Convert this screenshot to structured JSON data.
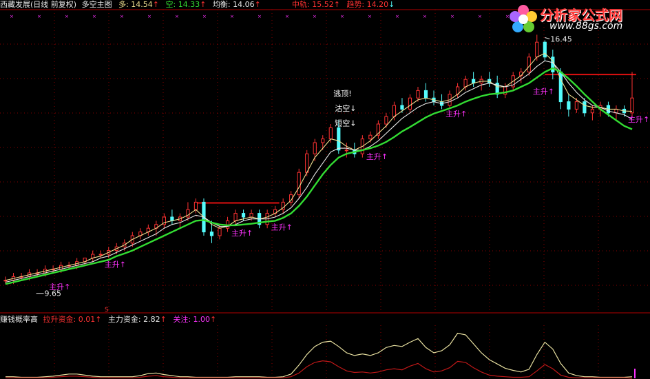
{
  "header": {
    "name": "西藏发展(日线 前复权)",
    "indicator": "多空主图",
    "long_label": "多: 14.54",
    "short_label": "空: 14.33",
    "balance_label": "均衡: 14.06",
    "mid_label": "中轨: 15.52",
    "trend_label": "趋势: 14.20",
    "arrow_up": "↑",
    "arrow_down": "↓"
  },
  "sub_header": {
    "name": "赚钱概率高",
    "pull_label": "拉升资金: 0.01",
    "main_label": "主力资金: 2.82",
    "focus_label": "关注: 1.00",
    "arrow_up": "↑"
  },
  "logo": {
    "title": "分析家公式网",
    "url": "www.88gs.com"
  },
  "annotations": {
    "escape_top": "逃顶!",
    "clear_short": "沽空↓",
    "short_short": "短空↓",
    "high_price": "16.45",
    "low_price": "9.65",
    "signal": "主升↑",
    "marker_s": "S"
  },
  "colors": {
    "background": "#000000",
    "up": "#ff3232",
    "down": "#54fcfc",
    "ma_green": "#33dd33",
    "ma_white": "#e8e8e8",
    "ma_yellow": "#f0e090",
    "resistance": "#e01010",
    "pull_line": "#c01818",
    "main_line": "#e8e0a0",
    "signal": "#ff33ff",
    "grid": "#8b0000"
  },
  "chart_data": [
    {
      "type": "candlestick",
      "title": "西藏发展(日线 前复权)",
      "ylim": [
        9.2,
        17.2
      ],
      "candles": [
        [
          10.0,
          10.1,
          9.9,
          10.0
        ],
        [
          10.0,
          10.2,
          9.9,
          10.1
        ],
        [
          10.1,
          10.2,
          10.0,
          10.1
        ],
        [
          10.1,
          10.3,
          10.0,
          10.2
        ],
        [
          10.2,
          10.3,
          10.1,
          10.2
        ],
        [
          10.2,
          10.4,
          10.1,
          10.3
        ],
        [
          10.3,
          10.4,
          10.2,
          10.3
        ],
        [
          10.3,
          10.5,
          10.2,
          10.4
        ],
        [
          10.4,
          10.5,
          10.3,
          10.4
        ],
        [
          10.4,
          10.6,
          10.3,
          10.5
        ],
        [
          10.5,
          10.6,
          10.4,
          10.6
        ],
        [
          10.6,
          10.8,
          10.5,
          10.7
        ],
        [
          10.7,
          10.8,
          10.6,
          10.7
        ],
        [
          10.7,
          10.9,
          10.6,
          10.8
        ],
        [
          10.8,
          11.0,
          10.7,
          10.9
        ],
        [
          10.9,
          11.1,
          10.8,
          11.0
        ],
        [
          11.0,
          11.3,
          10.9,
          11.2
        ],
        [
          11.2,
          11.4,
          11.1,
          11.3
        ],
        [
          11.3,
          11.5,
          11.2,
          11.4
        ],
        [
          11.4,
          11.6,
          11.2,
          11.5
        ],
        [
          11.5,
          11.8,
          11.4,
          11.7
        ],
        [
          11.7,
          11.9,
          11.5,
          11.6
        ],
        [
          11.6,
          11.8,
          11.4,
          11.7
        ],
        [
          11.7,
          12.1,
          11.6,
          11.9
        ],
        [
          11.9,
          12.2,
          11.8,
          12.1
        ],
        [
          12.1,
          12.2,
          11.2,
          11.3
        ],
        [
          11.3,
          11.6,
          11.0,
          11.2
        ],
        [
          11.2,
          11.5,
          11.1,
          11.4
        ],
        [
          11.4,
          11.7,
          11.3,
          11.6
        ],
        [
          11.6,
          11.9,
          11.5,
          11.8
        ],
        [
          11.8,
          11.9,
          11.6,
          11.7
        ],
        [
          11.7,
          11.9,
          11.6,
          11.8
        ],
        [
          11.8,
          11.9,
          11.4,
          11.5
        ],
        [
          11.5,
          11.9,
          11.4,
          11.8
        ],
        [
          11.8,
          12.0,
          11.7,
          11.9
        ],
        [
          11.9,
          12.2,
          11.8,
          12.1
        ],
        [
          12.1,
          12.4,
          12.0,
          12.3
        ],
        [
          12.3,
          13.0,
          12.2,
          12.9
        ],
        [
          12.9,
          13.5,
          12.8,
          13.4
        ],
        [
          13.4,
          13.8,
          13.2,
          13.7
        ],
        [
          13.7,
          13.9,
          13.5,
          13.8
        ],
        [
          13.8,
          14.2,
          13.7,
          14.1
        ],
        [
          14.1,
          14.3,
          13.4,
          13.5
        ],
        [
          13.5,
          13.7,
          13.3,
          13.5
        ],
        [
          13.5,
          13.7,
          13.3,
          13.4
        ],
        [
          13.4,
          13.9,
          13.3,
          13.8
        ],
        [
          13.8,
          14.0,
          13.7,
          13.9
        ],
        [
          13.9,
          14.3,
          13.8,
          14.2
        ],
        [
          14.2,
          14.5,
          14.1,
          14.4
        ],
        [
          14.4,
          14.8,
          14.3,
          14.7
        ],
        [
          14.7,
          14.9,
          14.5,
          14.6
        ],
        [
          14.6,
          15.0,
          14.5,
          14.9
        ],
        [
          14.9,
          15.2,
          14.8,
          15.1
        ],
        [
          15.1,
          15.3,
          14.8,
          14.9
        ],
        [
          14.9,
          15.1,
          14.7,
          14.8
        ],
        [
          14.8,
          15.0,
          14.6,
          14.7
        ],
        [
          14.7,
          15.1,
          14.6,
          15.0
        ],
        [
          15.0,
          15.3,
          14.9,
          15.2
        ],
        [
          15.2,
          15.5,
          15.1,
          15.4
        ],
        [
          15.4,
          15.6,
          15.2,
          15.3
        ],
        [
          15.3,
          15.5,
          15.1,
          15.4
        ],
        [
          15.4,
          15.6,
          15.2,
          15.3
        ],
        [
          15.3,
          15.5,
          14.9,
          15.0
        ],
        [
          15.0,
          15.3,
          14.9,
          15.2
        ],
        [
          15.2,
          15.6,
          15.1,
          15.5
        ],
        [
          15.5,
          15.7,
          15.3,
          15.6
        ],
        [
          15.6,
          16.1,
          15.5,
          16.0
        ],
        [
          16.0,
          16.6,
          15.9,
          16.4
        ],
        [
          16.4,
          16.45,
          15.9,
          16.0
        ],
        [
          16.0,
          16.2,
          15.4,
          15.6
        ],
        [
          15.6,
          15.7,
          14.6,
          14.8
        ],
        [
          14.8,
          15.0,
          14.4,
          14.6
        ],
        [
          14.6,
          14.9,
          14.5,
          14.8
        ],
        [
          14.8,
          14.9,
          14.4,
          14.5
        ],
        [
          14.5,
          14.7,
          14.3,
          14.6
        ],
        [
          14.6,
          14.8,
          14.4,
          14.7
        ],
        [
          14.7,
          14.8,
          14.4,
          14.5
        ],
        [
          14.5,
          14.7,
          14.3,
          14.6
        ],
        [
          14.6,
          14.7,
          14.4,
          14.5
        ],
        [
          14.5,
          15.6,
          14.4,
          14.9
        ]
      ],
      "series": [
        {
          "name": "多",
          "color": "#f0e090",
          "values": [
            10.0,
            10.05,
            10.1,
            10.15,
            10.2,
            10.25,
            10.3,
            10.35,
            10.4,
            10.45,
            10.5,
            10.6,
            10.65,
            10.75,
            10.85,
            10.95,
            11.1,
            11.2,
            11.3,
            11.4,
            11.55,
            11.6,
            11.65,
            11.75,
            11.9,
            11.7,
            11.5,
            11.4,
            11.45,
            11.6,
            11.65,
            11.7,
            11.65,
            11.7,
            11.8,
            11.95,
            12.15,
            12.5,
            12.9,
            13.3,
            13.55,
            13.8,
            13.75,
            13.6,
            13.5,
            13.6,
            13.75,
            13.95,
            14.15,
            14.4,
            14.55,
            14.7,
            14.85,
            14.9,
            14.85,
            14.8,
            14.85,
            15.0,
            15.2,
            15.3,
            15.35,
            15.35,
            15.2,
            15.2,
            15.35,
            15.5,
            15.75,
            16.0,
            16.1,
            15.9,
            15.4,
            15.0,
            14.85,
            14.7,
            14.65,
            14.65,
            14.6,
            14.6,
            14.55,
            14.54
          ]
        },
        {
          "name": "空",
          "color": "#e8e8e8",
          "values": [
            9.95,
            10.0,
            10.05,
            10.1,
            10.15,
            10.2,
            10.25,
            10.3,
            10.35,
            10.4,
            10.45,
            10.5,
            10.6,
            10.65,
            10.75,
            10.85,
            10.95,
            11.05,
            11.15,
            11.25,
            11.4,
            11.5,
            11.55,
            11.65,
            11.75,
            11.7,
            11.55,
            11.45,
            11.45,
            11.5,
            11.6,
            11.65,
            11.65,
            11.65,
            11.7,
            11.8,
            11.95,
            12.2,
            12.5,
            12.85,
            13.15,
            13.45,
            13.55,
            13.55,
            13.5,
            13.5,
            13.6,
            13.75,
            13.95,
            14.15,
            14.35,
            14.5,
            14.65,
            14.75,
            14.8,
            14.75,
            14.8,
            14.9,
            15.05,
            15.15,
            15.25,
            15.3,
            15.25,
            15.2,
            15.25,
            15.4,
            15.55,
            15.75,
            15.9,
            15.85,
            15.6,
            15.3,
            15.05,
            14.85,
            14.7,
            14.65,
            14.55,
            14.5,
            14.45,
            14.33
          ]
        },
        {
          "name": "均衡",
          "color": "#33dd33",
          "values": [
            9.9,
            9.95,
            10.0,
            10.05,
            10.1,
            10.15,
            10.2,
            10.25,
            10.3,
            10.35,
            10.4,
            10.45,
            10.5,
            10.55,
            10.65,
            10.72,
            10.8,
            10.9,
            11.0,
            11.1,
            11.2,
            11.3,
            11.4,
            11.5,
            11.6,
            11.62,
            11.55,
            11.5,
            11.48,
            11.48,
            11.5,
            11.52,
            11.55,
            11.58,
            11.6,
            11.68,
            11.8,
            12.0,
            12.25,
            12.55,
            12.85,
            13.1,
            13.3,
            13.4,
            13.45,
            13.5,
            13.55,
            13.62,
            13.72,
            13.85,
            14.0,
            14.12,
            14.25,
            14.38,
            14.48,
            14.55,
            14.62,
            14.7,
            14.8,
            14.88,
            14.95,
            15.0,
            15.02,
            15.05,
            15.1,
            15.2,
            15.3,
            15.45,
            15.6,
            15.7,
            15.6,
            15.42,
            15.22,
            15.0,
            14.8,
            14.6,
            14.45,
            14.3,
            14.15,
            14.06
          ]
        }
      ],
      "resistance_segments": [
        {
          "from": 24,
          "to": 34,
          "price": 12.08
        },
        {
          "from": 68,
          "to": 79,
          "price": 15.53
        }
      ],
      "signals": [
        {
          "index": 6,
          "price": 10.05,
          "label": "主升↑"
        },
        {
          "index": 13,
          "price": 10.65,
          "label": "主升↑"
        },
        {
          "index": 29,
          "price": 11.5,
          "label": "主升↑"
        },
        {
          "index": 34,
          "price": 11.65,
          "label": "主升↑"
        },
        {
          "index": 46,
          "price": 13.55,
          "label": "主升↑"
        },
        {
          "index": 56,
          "price": 14.7,
          "label": "主升↑"
        },
        {
          "index": 67,
          "price": 15.3,
          "label": "主升↑"
        },
        {
          "index": 79,
          "price": 14.55,
          "label": "主升↑"
        }
      ],
      "high": {
        "index": 68,
        "price": 16.45
      },
      "low": {
        "index": 3,
        "price": 9.65
      }
    },
    {
      "type": "line",
      "title": "赚钱概率高",
      "ylim": [
        0,
        10
      ],
      "series": [
        {
          "name": "主力资金",
          "color": "#e8e0a0",
          "values": [
            0.3,
            0.3,
            0.2,
            0.2,
            0.2,
            0.3,
            0.4,
            0.6,
            0.8,
            0.8,
            0.6,
            0.4,
            0.3,
            0.3,
            0.3,
            0.3,
            0.3,
            0.5,
            0.9,
            1.0,
            0.7,
            0.5,
            0.3,
            0.3,
            0.2,
            0.2,
            0.2,
            0.2,
            0.2,
            0.3,
            0.3,
            0.3,
            0.3,
            0.2,
            0.2,
            0.3,
            0.8,
            2.5,
            4.5,
            6.0,
            6.8,
            7.0,
            6.0,
            4.8,
            4.3,
            4.6,
            4.3,
            4.8,
            5.8,
            6.2,
            6.0,
            6.8,
            7.5,
            5.8,
            4.8,
            5.2,
            6.3,
            8.5,
            8.2,
            6.5,
            4.8,
            3.5,
            2.7,
            1.9,
            1.5,
            1.2,
            1.7,
            4.5,
            6.8,
            5.5,
            2.8,
            1.0,
            0.5,
            0.3,
            0.3,
            0.2,
            0.2,
            0.2,
            0.2,
            0.3
          ]
        },
        {
          "name": "拉升资金",
          "color": "#c01818",
          "values": [
            0.1,
            0.1,
            0.1,
            0.1,
            0.1,
            0.1,
            0.2,
            0.3,
            0.4,
            0.4,
            0.3,
            0.2,
            0.1,
            0.1,
            0.1,
            0.1,
            0.1,
            0.2,
            0.4,
            0.5,
            0.3,
            0.2,
            0.1,
            0.1,
            0.1,
            0.1,
            0.1,
            0.1,
            0.1,
            0.1,
            0.1,
            0.1,
            0.1,
            0.1,
            0.1,
            0.1,
            0.3,
            1.0,
            2.2,
            3.0,
            3.3,
            3.1,
            2.2,
            1.4,
            1.1,
            1.2,
            1.0,
            1.2,
            1.6,
            1.8,
            1.6,
            2.3,
            2.8,
            1.8,
            1.2,
            1.4,
            2.0,
            3.2,
            3.0,
            2.0,
            1.2,
            0.6,
            0.4,
            0.3,
            0.2,
            0.2,
            0.3,
            1.4,
            2.6,
            1.8,
            0.6,
            0.2,
            0.1,
            0.1,
            0.1,
            0.1,
            0.1,
            0.1,
            0.1,
            0.01
          ]
        }
      ]
    }
  ]
}
